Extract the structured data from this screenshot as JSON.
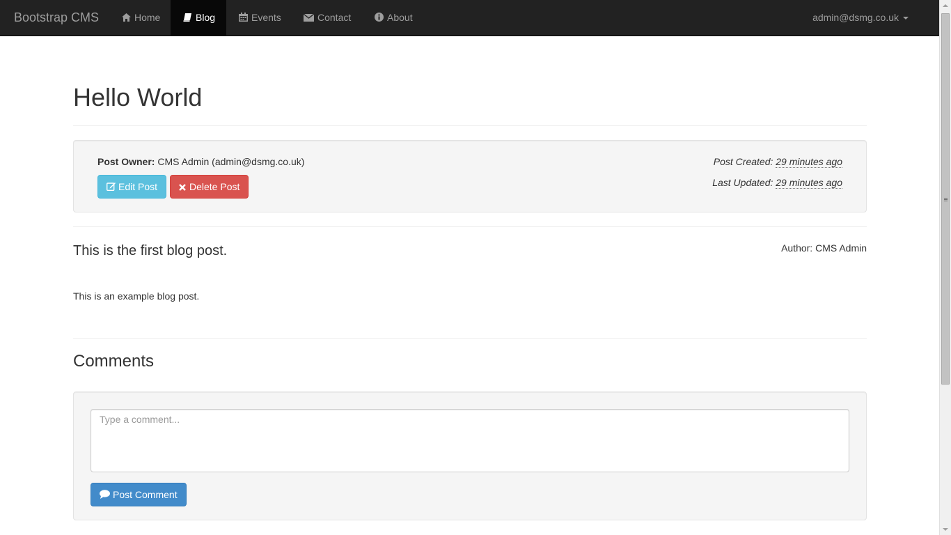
{
  "navbar": {
    "brand": "Bootstrap CMS",
    "items": [
      {
        "label": "Home",
        "icon": "home-icon"
      },
      {
        "label": "Blog",
        "icon": "book-icon",
        "active": true
      },
      {
        "label": "Events",
        "icon": "calendar-icon"
      },
      {
        "label": "Contact",
        "icon": "envelope-icon"
      },
      {
        "label": "About",
        "icon": "info-icon"
      }
    ],
    "user": "admin@dsmg.co.uk"
  },
  "post": {
    "title": "Hello World",
    "owner_label": "Post Owner:",
    "owner_value": "CMS Admin (admin@dsmg.co.uk)",
    "edit_label": "Edit Post",
    "delete_label": "Delete Post",
    "created_label": "Post Created:",
    "created_value": "29 minutes ago",
    "updated_label": "Last Updated:",
    "updated_value": "29 minutes ago",
    "summary": "This is the first blog post.",
    "author": "Author: CMS Admin",
    "body": "This is an example blog post."
  },
  "comments": {
    "title": "Comments",
    "placeholder": "Type a comment...",
    "submit_label": "Post Comment"
  },
  "colors": {
    "navbar_bg": "#222222",
    "info": "#5bc0de",
    "danger": "#d9534f",
    "primary": "#428bca"
  }
}
